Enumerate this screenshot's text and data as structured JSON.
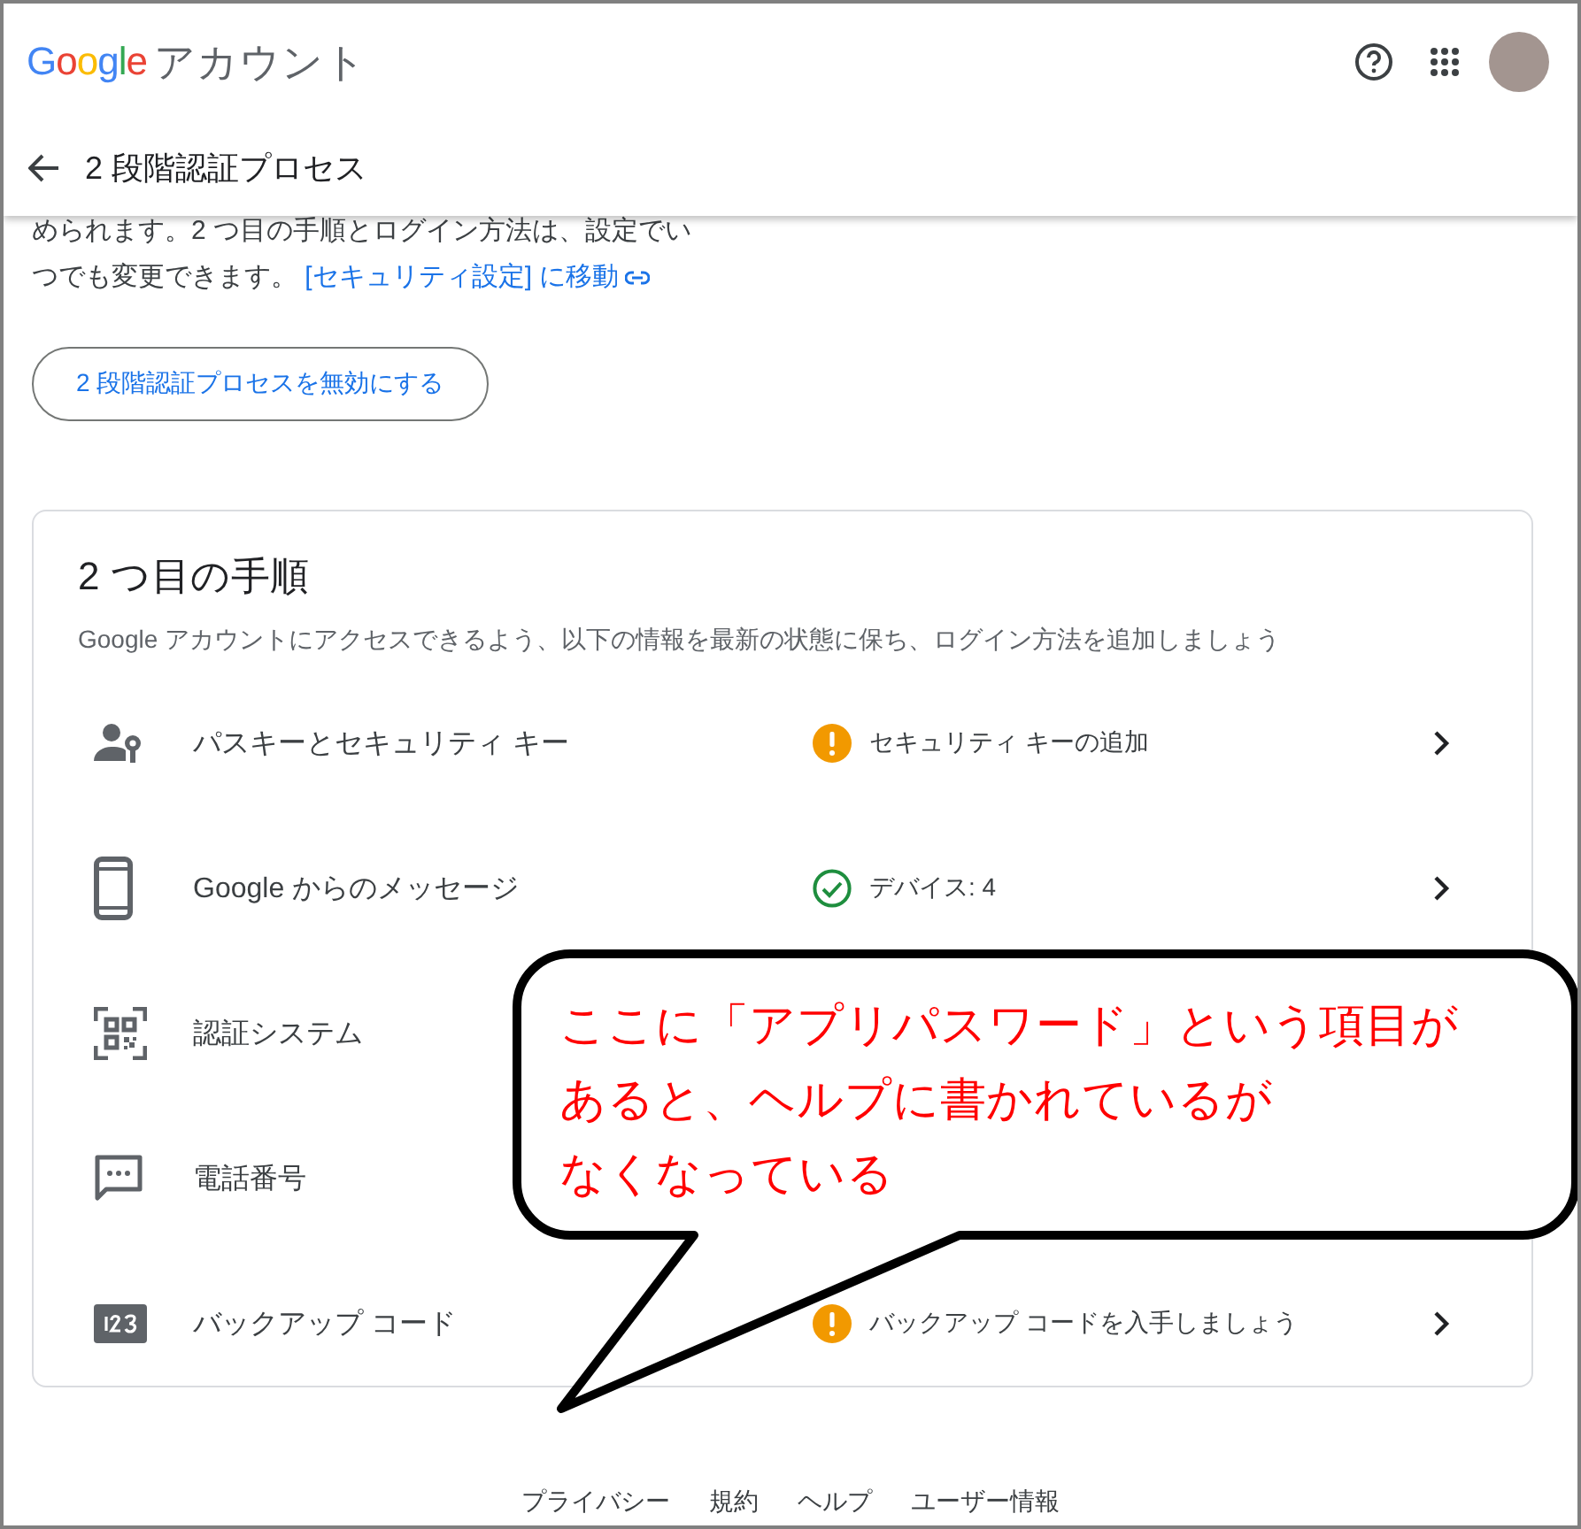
{
  "header": {
    "logo": "Google",
    "product": "アカウント",
    "page_title": "2 段階認証プロセス"
  },
  "intro": {
    "lines": [
      "められます。2 つ目の手順とログイン方法は、設定でい",
      "つでも変更できます。"
    ],
    "link": "[セキュリティ設定] に移動"
  },
  "disable_button": "2 段階認証プロセスを無効にする",
  "card": {
    "title": "2 つ目の手順",
    "subtitle": "Google アカウントにアクセスできるよう、以下の情報を最新の状態に保ち、ログイン方法を追加しましょう",
    "rows": [
      {
        "label": "パスキーとセキュリティ キー",
        "status": {
          "kind": "warning",
          "text": "セキュリティ キーの追加"
        },
        "chevron": true
      },
      {
        "label": "Google からのメッセージ",
        "status": {
          "kind": "ok",
          "text": "デバイス: 4"
        },
        "chevron": true
      },
      {
        "label": "認証システム",
        "chevron": false
      },
      {
        "label": "電話番号",
        "chevron": false
      },
      {
        "label": "バックアップ コード",
        "status": {
          "kind": "warning",
          "text": "バックアップ コードを入手しましょう"
        },
        "chevron": true
      }
    ]
  },
  "footer": [
    "プライバシー",
    "規約",
    "ヘルプ",
    "ユーザー情報"
  ],
  "callout": {
    "lines": [
      "ここに「アプリパスワード」という項目が",
      "あると、ヘルプに書かれているが",
      "なくなっている"
    ]
  }
}
